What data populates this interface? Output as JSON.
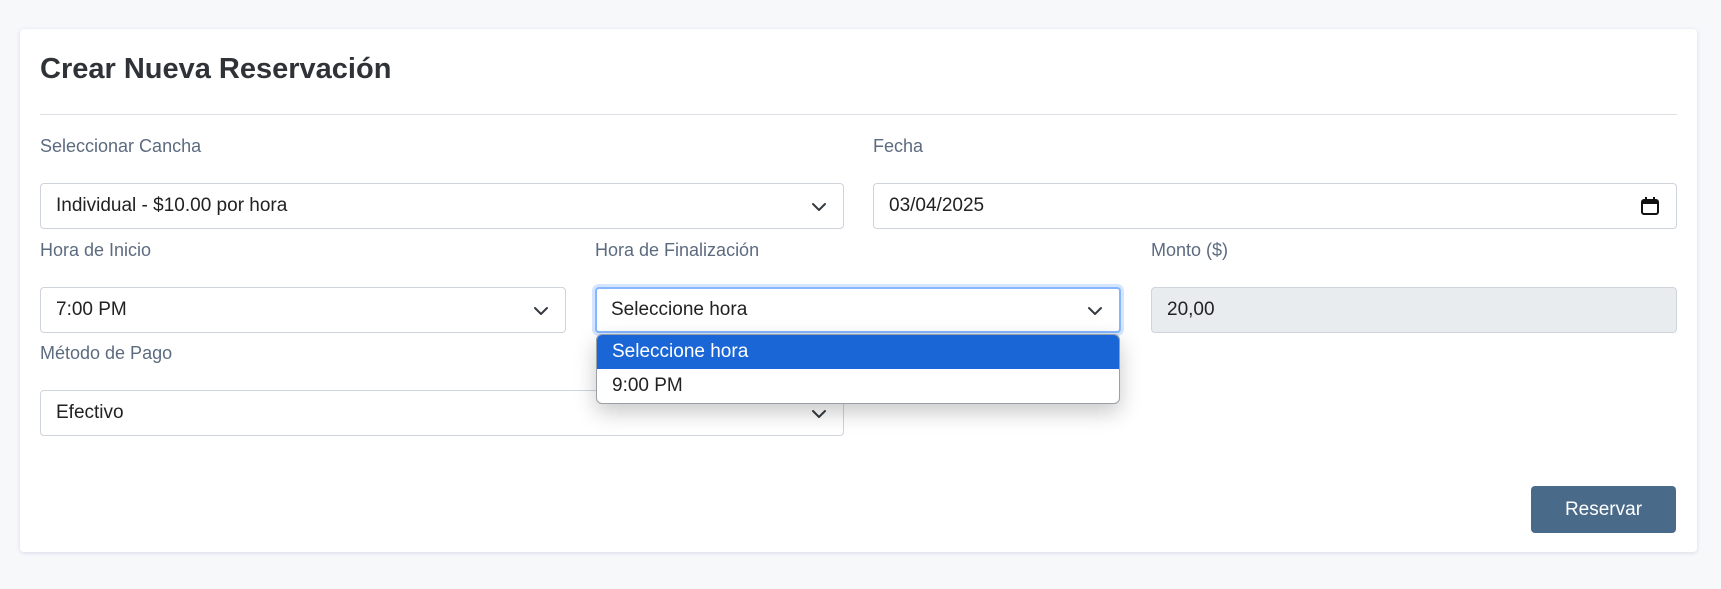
{
  "form": {
    "title": "Crear Nueva Reservación",
    "court": {
      "label": "Seleccionar Cancha",
      "value": "Individual - $10.00 por hora"
    },
    "date": {
      "label": "Fecha",
      "value": "03/04/2025"
    },
    "start_time": {
      "label": "Hora de Inicio",
      "value": "7:00 PM"
    },
    "end_time": {
      "label": "Hora de Finalización",
      "value": "Seleccione hora",
      "options": [
        "Seleccione hora",
        "9:00 PM"
      ],
      "selected_index": 0
    },
    "amount": {
      "label": "Monto ($)",
      "value": "20,00"
    },
    "payment": {
      "label": "Método de Pago",
      "value": "Efectivo"
    },
    "submit_label": "Reservar"
  },
  "colors": {
    "page_background": "#f7f8fa",
    "button": "#4a6a8a",
    "dropdown_highlight": "#1a66d6",
    "label_text": "#5c6b7f"
  },
  "icons": {
    "select": "chevron-down-icon",
    "date": "calendar-icon"
  }
}
